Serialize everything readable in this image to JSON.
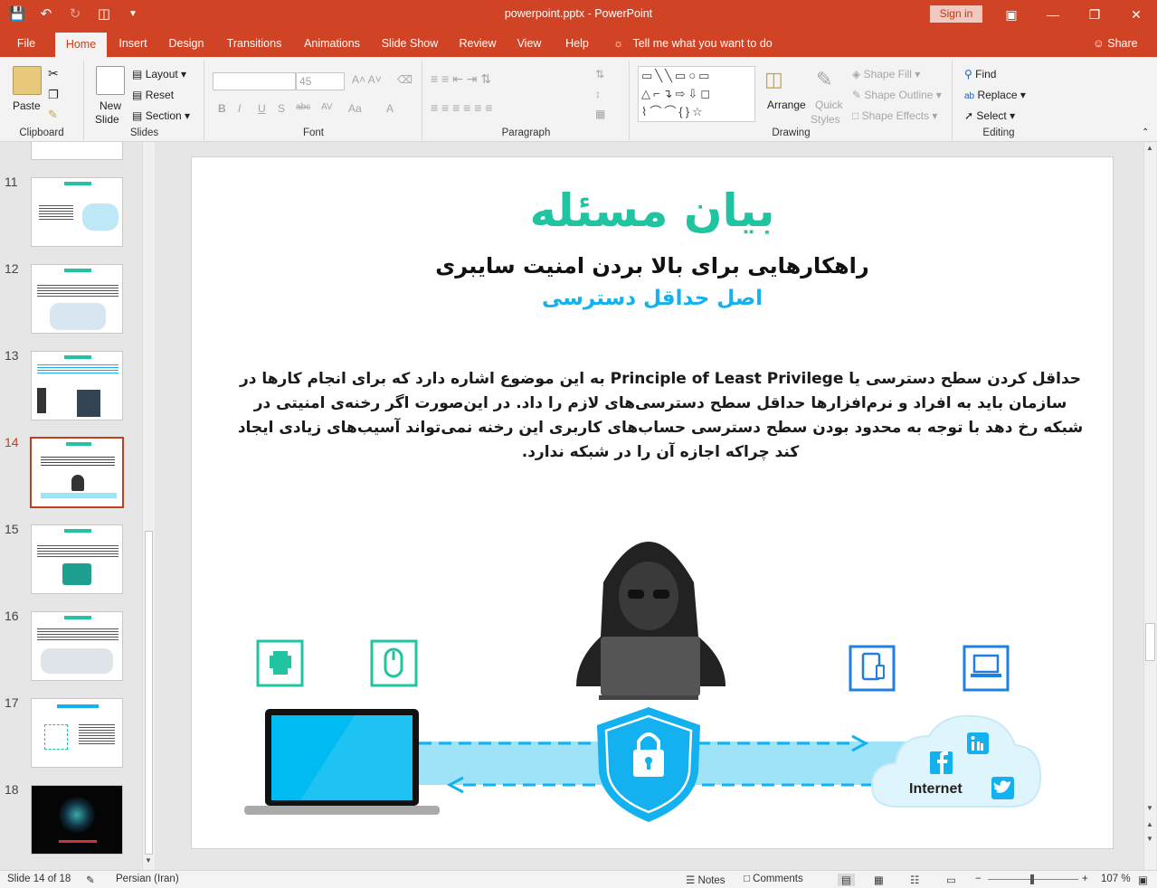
{
  "window": {
    "title": "powerpoint.pptx  -  PowerPoint",
    "sign_in": "Sign in"
  },
  "tabs": [
    "File",
    "Home",
    "Insert",
    "Design",
    "Transitions",
    "Animations",
    "Slide Show",
    "Review",
    "View",
    "Help"
  ],
  "active_tab": "Home",
  "tell_me": "Tell me what you want to do",
  "share": "Share",
  "ribbon": {
    "clipboard": {
      "label": "Clipboard",
      "paste": "Paste"
    },
    "slides": {
      "label": "Slides",
      "new_slide_1": "New",
      "new_slide_2": "Slide",
      "layout": "Layout",
      "reset": "Reset",
      "section": "Section"
    },
    "font": {
      "label": "Font",
      "size": "45"
    },
    "paragraph": {
      "label": "Paragraph"
    },
    "drawing": {
      "label": "Drawing",
      "arrange": "Arrange",
      "quick_styles_1": "Quick",
      "quick_styles_2": "Styles",
      "shape_fill": "Shape Fill",
      "shape_outline": "Shape Outline",
      "shape_effects": "Shape Effects"
    },
    "editing": {
      "label": "Editing",
      "find": "Find",
      "replace": "Replace",
      "select": "Select"
    }
  },
  "thumbnails": {
    "numbers": [
      "11",
      "12",
      "13",
      "14",
      "15",
      "16",
      "17",
      "18"
    ],
    "selected": "14"
  },
  "slide": {
    "title": "بیان مسئله",
    "subtitle": "راهکارهایی برای بالا بردن امنیت سایبری",
    "subtitle2": "اصل حداقل دسترسی",
    "body": "حداقل کردن سطح دسترسی یا  Principle of Least Privilege به این موضوع اشاره دارد که برای انجام کارها در سازمان باید به افراد و نرم‌افزارها حداقل سطح دسترسی‌های لازم را داد. در این‌صورت اگر رخنه‌ی امنیتی در شبکه رخ دهد با توجه به محدود بودن سطح دسترسی حساب‌های کاربری این رخنه نمی‌تواند آسیب‌های زیادی ایجاد کند چراکه اجازه آن را در شبکه ندارد.",
    "internet_label": "Internet"
  },
  "status": {
    "slide_info": "Slide 14 of 18",
    "language": "Persian (Iran)",
    "notes": "Notes",
    "comments": "Comments",
    "zoom": "107 %"
  },
  "colors": {
    "accent": "#d04425",
    "teal": "#20c4a0",
    "blue": "#13b1f0",
    "icon_blue": "#1f7fe0"
  }
}
